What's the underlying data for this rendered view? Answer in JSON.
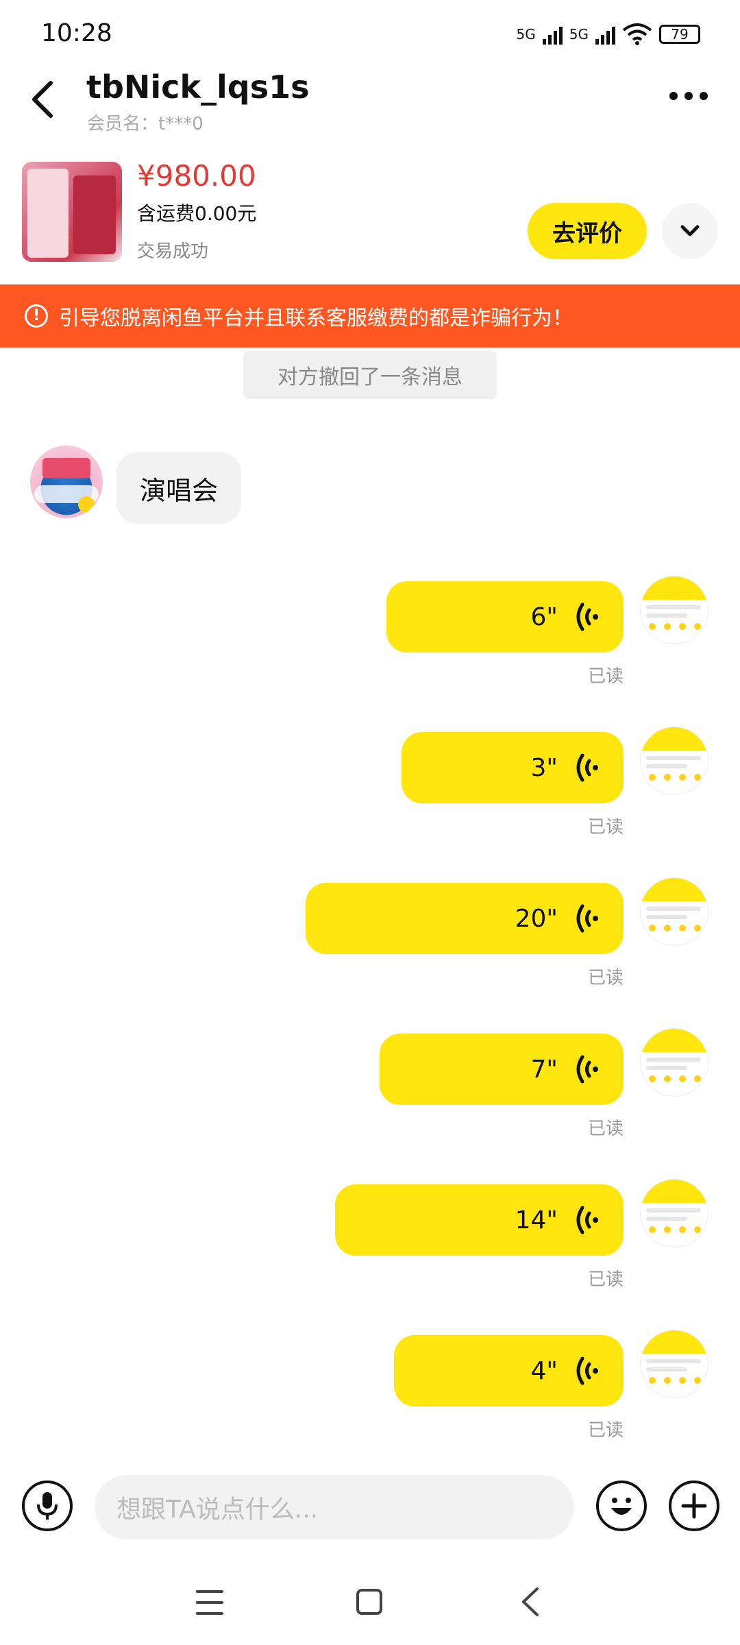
{
  "status_bar": {
    "time": "10:28",
    "network_1": "5G",
    "network_2": "5G",
    "battery": "79"
  },
  "header": {
    "title": "tbNick_lqs1s",
    "subtitle": "会员名：t***0"
  },
  "product": {
    "price": "¥980.00",
    "shipping": "含运费0.00元",
    "status": "交易成功",
    "review_button": "去评价"
  },
  "warning_banner": {
    "text": "引导您脱离闲鱼平台并且联系客服缴费的都是诈骗行为！"
  },
  "recall_notice": "对方撤回了一条消息",
  "messages": {
    "incoming": {
      "text": "演唱会"
    },
    "voice": [
      {
        "duration": "6\"",
        "read": "已读",
        "width_fraction": 0.32
      },
      {
        "duration": "3\"",
        "read": "已读",
        "width_fraction": 0.3
      },
      {
        "duration": "20\"",
        "read": "已读",
        "width_fraction": 0.43
      },
      {
        "duration": "7\"",
        "read": "已读",
        "width_fraction": 0.33
      },
      {
        "duration": "14\"",
        "read": "已读",
        "width_fraction": 0.39
      },
      {
        "duration": "4\"",
        "read": "已读",
        "width_fraction": 0.31
      }
    ]
  },
  "input_bar": {
    "placeholder": "想跟TA说点什么..."
  },
  "icons": {
    "back": "chevron-left-icon",
    "more": "more-dots-icon",
    "expand": "chevron-down-icon",
    "warning": "exclamation-circle-icon",
    "voice": "voice-wave-icon",
    "mic": "microphone-icon",
    "emoji": "smiley-icon",
    "plus": "plus-circle-icon"
  },
  "colors": {
    "accent_yellow": "#ffe60f",
    "price_red": "#e53935",
    "warning_orange": "#ff5722"
  }
}
